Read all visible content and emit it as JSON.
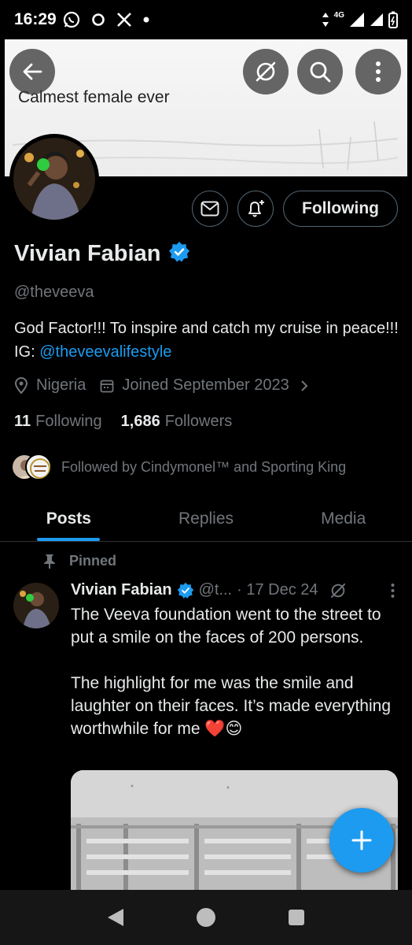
{
  "status_bar": {
    "time": "16:29",
    "network": "4G",
    "icons": [
      "whatsapp-icon",
      "sync-icon",
      "x-icon",
      "dot-icon",
      "data-arrows-icon",
      "signal-icon",
      "battery-icon"
    ]
  },
  "banner": {
    "text": "Calmest female ever",
    "buttons": [
      "back-icon",
      "grok-icon",
      "search-icon",
      "more-icon"
    ]
  },
  "profile": {
    "name": "Vivian Fabian",
    "handle": "@theveeva",
    "bio_text": "God Factor!!! To inspire and catch my cruise in peace!!! IG: ",
    "bio_link": "@theveevalifestyle",
    "location": "Nigeria",
    "joined": "Joined September 2023",
    "following_count": "11",
    "following_label": "Following",
    "followers_count": "1,686",
    "followers_label": "Followers",
    "followed_by": "Followed by Cindymonel™ and Sporting King",
    "follow_button": "Following",
    "verified_color": "#1d9bf0"
  },
  "tabs": [
    {
      "label": "Posts",
      "active": true
    },
    {
      "label": "Replies",
      "active": false
    },
    {
      "label": "Media",
      "active": false
    }
  ],
  "post": {
    "pinned_label": "Pinned",
    "author": "Vivian Fabian",
    "handle": "@t...",
    "date": "· 17 Dec 24",
    "text": "The Veeva foundation went to the street to put a smile on the faces of 200 persons.\n\nThe highlight for me was the smile and laughter on their faces. It’s made everything worthwhile for me ❤️😊"
  },
  "colors": {
    "accent": "#1d9bf0",
    "secondary_text": "#71767b",
    "primary_text": "#e7e9ea",
    "background": "#000000"
  }
}
